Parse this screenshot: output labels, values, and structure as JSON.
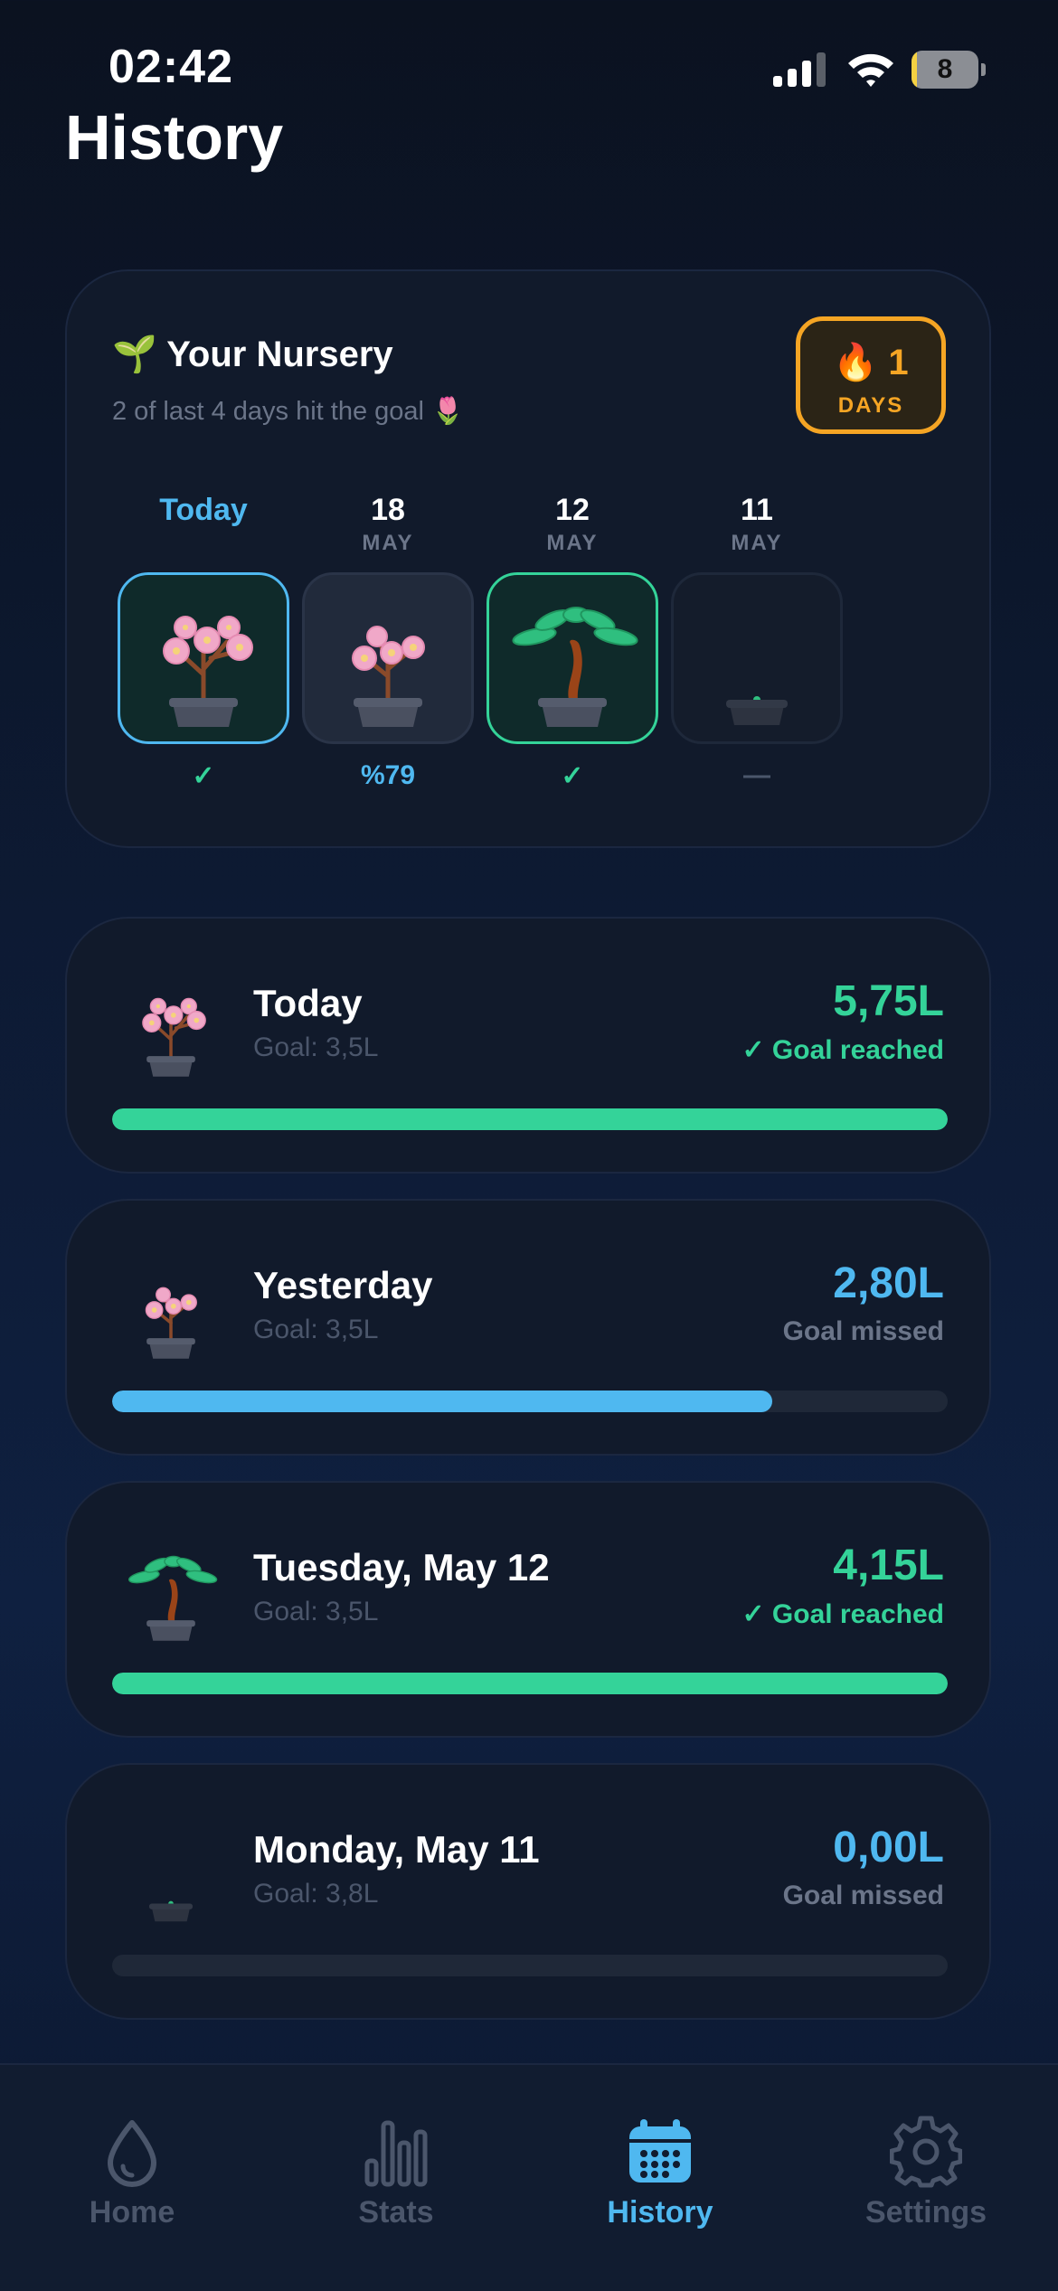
{
  "status_bar": {
    "time": "02:42",
    "battery": "8",
    "battery_level": 0.08
  },
  "page": {
    "title": "History"
  },
  "nursery": {
    "title": "🌱 Your Nursery",
    "subtitle": "2 of last 4 days hit the goal 🌷",
    "streak": {
      "value": "🔥 1",
      "unit": "DAYS"
    },
    "days": [
      {
        "label": "Today",
        "month": "",
        "plant": "blossom-tree",
        "status": "✓",
        "status_color": "#34d399",
        "highlight": "#4fb8f0"
      },
      {
        "label": "18",
        "month": "MAY",
        "plant": "small-blossom",
        "status": "%79",
        "status_color": "#4fb8f0",
        "highlight": ""
      },
      {
        "label": "12",
        "month": "MAY",
        "plant": "bonsai",
        "status": "✓",
        "status_color": "#34d399",
        "highlight": "#34d399"
      },
      {
        "label": "11",
        "month": "MAY",
        "plant": "empty-pot",
        "status": "—",
        "status_color": "#4b566b",
        "highlight": ""
      }
    ]
  },
  "logs": [
    {
      "title": "Today",
      "goal": "Goal: 3,5L",
      "amount": "5,75L",
      "status": "✓ Goal reached",
      "amount_color": "#34d399",
      "status_color": "#34d399",
      "progress": 1.0,
      "bar_color": "#34d399",
      "plant": "blossom-tree"
    },
    {
      "title": "Yesterday",
      "goal": "Goal: 3,5L",
      "amount": "2,80L",
      "status": "Goal missed",
      "amount_color": "#4fb8f0",
      "status_color": "#6b7589",
      "progress": 0.79,
      "bar_color": "#4fb8f0",
      "plant": "small-blossom"
    },
    {
      "title": "Tuesday, May 12",
      "goal": "Goal: 3,5L",
      "amount": "4,15L",
      "status": "✓ Goal reached",
      "amount_color": "#34d399",
      "status_color": "#34d399",
      "progress": 1.0,
      "bar_color": "#34d399",
      "plant": "bonsai"
    },
    {
      "title": "Monday, May 11",
      "goal": "Goal: 3,8L",
      "amount": "0,00L",
      "status": "Goal missed",
      "amount_color": "#4fb8f0",
      "status_color": "#6b7589",
      "progress": 0.0,
      "bar_color": "#4fb8f0",
      "plant": "empty-pot"
    }
  ],
  "tabs": [
    {
      "label": "Home",
      "icon": "droplet-icon",
      "active": false
    },
    {
      "label": "Stats",
      "icon": "bar-chart-icon",
      "active": false
    },
    {
      "label": "History",
      "icon": "calendar-icon",
      "active": true
    },
    {
      "label": "Settings",
      "icon": "gear-icon",
      "active": false
    }
  ],
  "colors": {
    "accent": "#4fb8f0",
    "success": "#34d399",
    "streak": "#f5a524",
    "inactive": "#4b566b"
  }
}
